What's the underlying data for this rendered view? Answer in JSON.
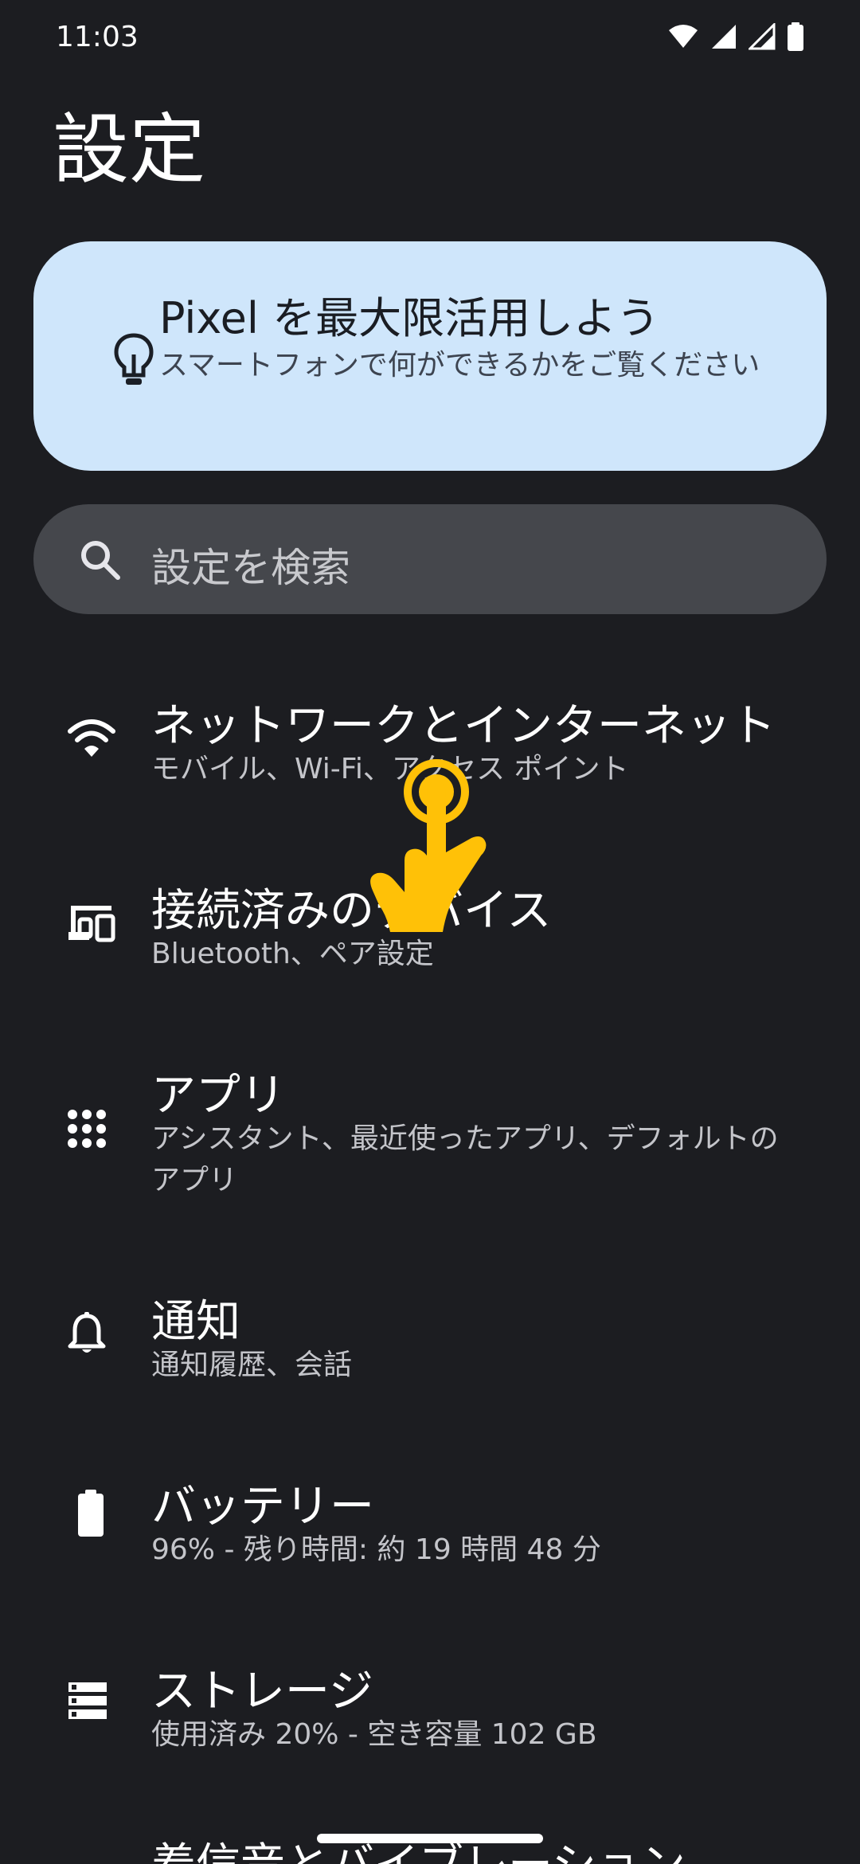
{
  "status_bar": {
    "time": "11:03",
    "icons": [
      "wifi-icon",
      "signal-icon",
      "signal-empty-icon",
      "battery-icon"
    ]
  },
  "page": {
    "title": "設定"
  },
  "suggestion": {
    "title": "Pixel を最大限活用しよう",
    "subtitle": "スマートフォンで何ができるかをご覧ください",
    "icon": "lightbulb-icon"
  },
  "search": {
    "placeholder": "設定を検索",
    "icon": "search-icon"
  },
  "settings": [
    {
      "title": "ネットワークとインターネット",
      "subtitle": "モバイル、Wi-Fi、アクセス ポイント",
      "icon": "wifi-icon"
    },
    {
      "title": "接続済みのデバイス",
      "subtitle": "Bluetooth、ペア設定",
      "icon": "devices-icon"
    },
    {
      "title": "アプリ",
      "subtitle": "アシスタント、最近使ったアプリ、デフォルトのアプリ",
      "icon": "apps-grid-icon"
    },
    {
      "title": "通知",
      "subtitle": "通知履歴、会話",
      "icon": "bell-icon"
    },
    {
      "title": "バッテリー",
      "subtitle": "96% - 残り時間: 約 19 時間 48 分",
      "icon": "battery-icon"
    },
    {
      "title": "ストレージ",
      "subtitle": "使用済み 20% - 空き容量 102 GB",
      "icon": "storage-icon"
    },
    {
      "title": "着信音とバイブレーション",
      "subtitle": "",
      "icon": "volume-icon"
    }
  ],
  "colors": {
    "background": "#1c1d21",
    "card": "#cfe6fb",
    "search": "#45474c",
    "tap_indicator": "#ffc107"
  }
}
